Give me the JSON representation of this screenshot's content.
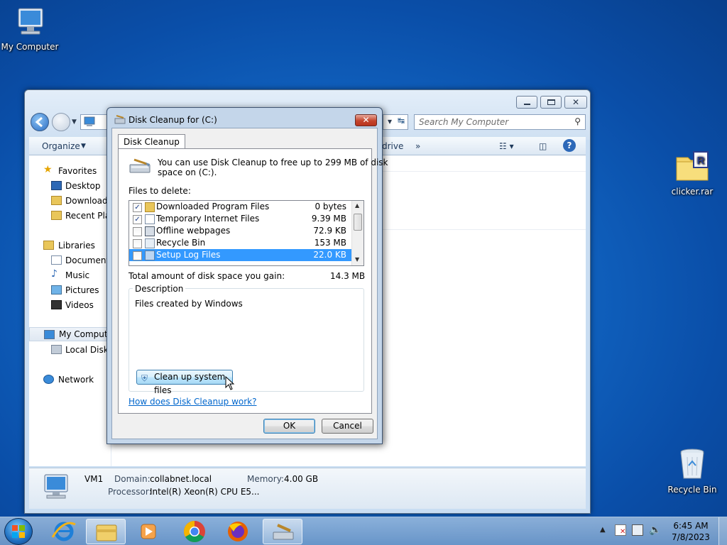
{
  "desktop": {
    "icons": [
      {
        "label": "My Computer"
      },
      {
        "label": "clicker.rar"
      },
      {
        "label": "Recycle Bin"
      }
    ]
  },
  "explorer": {
    "search_placeholder": "Search My Computer",
    "toolbar": {
      "organize": "Organize",
      "drive": "drive",
      "more": "»"
    },
    "nav": {
      "favorites": "Favorites",
      "desktop": "Desktop",
      "downloads": "Downloads",
      "recent": "Recent Plac",
      "libraries": "Libraries",
      "documents": "Documents",
      "music": "Music",
      "pictures": "Pictures",
      "videos": "Videos",
      "my_computer": "My Compute",
      "local_disk": "Local Disk (",
      "network": "Network"
    },
    "details": {
      "name": "VM1",
      "domain_label": "Domain:",
      "domain_value": "collabnet.local",
      "memory_label": "Memory:",
      "memory_value": "4.00 GB",
      "processor_label": "Processor:",
      "processor_value": "Intel(R) Xeon(R) CPU E5..."
    }
  },
  "dialog": {
    "title": "Disk Cleanup for  (C:)",
    "close": "✕",
    "tab": "Disk Cleanup",
    "intro": "You can use Disk Cleanup to free up to 299 MB of disk",
    "intro2": "space on  (C:).",
    "files_label": "Files to delete:",
    "files": [
      {
        "name": "Downloaded Program Files",
        "size": "0 bytes",
        "checked": true
      },
      {
        "name": "Temporary Internet Files",
        "size": "9.39 MB",
        "checked": true
      },
      {
        "name": "Offline webpages",
        "size": "72.9 KB",
        "checked": false
      },
      {
        "name": "Recycle Bin",
        "size": "153 MB",
        "checked": false
      },
      {
        "name": "Setup Log Files",
        "size": "22.0 KB",
        "checked": false,
        "selected": true
      }
    ],
    "total_label": "Total amount of disk space you gain:",
    "total_value": "14.3 MB",
    "description_label": "Description",
    "description_text": "Files created by Windows",
    "cleanup_button": "Clean up system files",
    "help_link": "How does Disk Cleanup work?",
    "ok": "OK",
    "cancel": "Cancel"
  },
  "taskbar": {
    "time": "6:45 AM",
    "date": "7/8/2023"
  }
}
